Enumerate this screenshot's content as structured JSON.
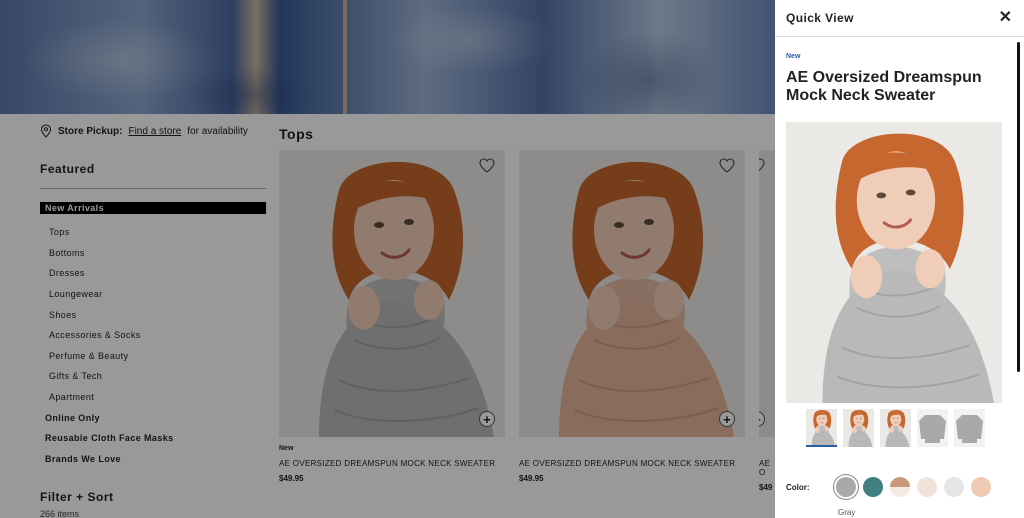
{
  "store_pickup": {
    "label": "Store Pickup:",
    "link": "Find a store",
    "suffix": "for availability"
  },
  "sidebar": {
    "heading": "Featured",
    "items": [
      {
        "label": "New Arrivals",
        "state": "active"
      },
      {
        "label": "Tops",
        "state": "sub"
      },
      {
        "label": "Bottoms",
        "state": "sub"
      },
      {
        "label": "Dresses",
        "state": "sub"
      },
      {
        "label": "Loungewear",
        "state": "sub"
      },
      {
        "label": "Shoes",
        "state": "sub"
      },
      {
        "label": "Accessories & Socks",
        "state": "sub"
      },
      {
        "label": "Perfume & Beauty",
        "state": "sub"
      },
      {
        "label": "Gifts & Tech",
        "state": "sub"
      },
      {
        "label": "Apartment",
        "state": "sub"
      },
      {
        "label": "Online Only",
        "state": "bold"
      },
      {
        "label": "Reusable Cloth Face Masks",
        "state": "bold"
      },
      {
        "label": "Brands We Love",
        "state": "bold"
      }
    ],
    "filter_sort": "Filter + Sort",
    "item_count": "266 items"
  },
  "grid": {
    "title": "Tops",
    "products": [
      {
        "badge": "New",
        "name": "AE OVERSIZED DREAMSPUN MOCK NECK SWEATER",
        "price": "$49.95",
        "sweater_color": "#b9b9b9"
      },
      {
        "badge": "",
        "name": "AE OVERSIZED DREAMSPUN MOCK NECK SWEATER",
        "price": "$49.95",
        "sweater_color": "#e4b59a"
      },
      {
        "badge": "",
        "name": "AE O",
        "price": "$49",
        "sweater_color": "#b9b9b9"
      }
    ]
  },
  "quick_view": {
    "title": "Quick View",
    "badge": "New",
    "product_name": "AE Oversized Dreamspun Mock Neck Sweater",
    "color_label": "Color:",
    "selected_color": "Gray",
    "swatches": [
      "#a9a9a9",
      "#3f7f7f",
      "#c99a78",
      "#f1e3da",
      "#e6e6e6",
      "#eec9b3"
    ],
    "thumbnails": [
      "closeup-front",
      "hood-up",
      "full-front",
      "flat-front",
      "flat-back"
    ]
  },
  "colors": {
    "accent": "#2a5ca8",
    "hair": "#c5672e",
    "skin": "#f0cdb8"
  }
}
